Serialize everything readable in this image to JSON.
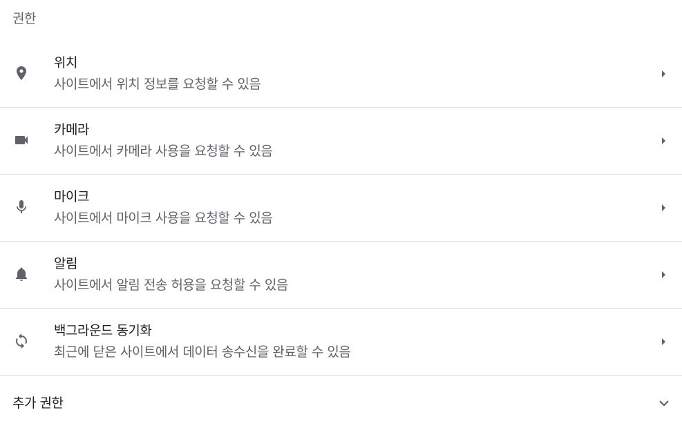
{
  "section": {
    "title": "권한"
  },
  "permissions": [
    {
      "key": "location",
      "icon": "location-pin-icon",
      "title": "위치",
      "description": "사이트에서 위치 정보를 요청할 수 있음"
    },
    {
      "key": "camera",
      "icon": "video-camera-icon",
      "title": "카메라",
      "description": "사이트에서 카메라 사용을 요청할 수 있음"
    },
    {
      "key": "microphone",
      "icon": "microphone-icon",
      "title": "마이크",
      "description": "사이트에서 마이크 사용을 요청할 수 있음"
    },
    {
      "key": "notifications",
      "icon": "bell-icon",
      "title": "알림",
      "description": "사이트에서 알림 전송 허용을 요청할 수 있음"
    },
    {
      "key": "background-sync",
      "icon": "sync-icon",
      "title": "백그라운드 동기화",
      "description": "최근에 닫은 사이트에서 데이터 송수신을 완료할 수 있음"
    }
  ],
  "more": {
    "label": "추가 권한",
    "icon": "chevron-down-icon"
  },
  "colors": {
    "icon": "#5f6368",
    "divider": "#e0e0e0",
    "title": "#202124",
    "secondary": "#5f6368"
  }
}
